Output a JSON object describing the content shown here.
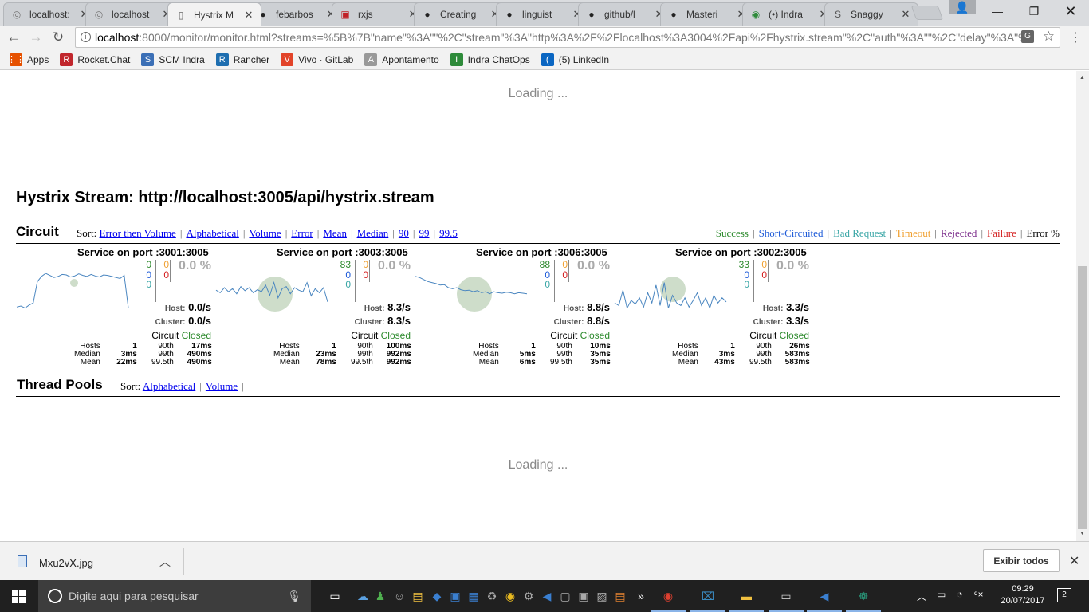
{
  "browser": {
    "tabs": [
      {
        "label": "localhost:",
        "favicon": "globe-icon"
      },
      {
        "label": "localhost",
        "favicon": "globe-icon"
      },
      {
        "label": "Hystrix M",
        "favicon": "page-icon",
        "active": true
      },
      {
        "label": "febarbos",
        "favicon": "github-icon"
      },
      {
        "label": "rxjs",
        "favicon": "npm-icon"
      },
      {
        "label": "Creating",
        "favicon": "github-icon"
      },
      {
        "label": "linguist",
        "favicon": "github-icon"
      },
      {
        "label": "github/l",
        "favicon": "github-icon"
      },
      {
        "label": "Masteri",
        "favicon": "github-icon"
      },
      {
        "label": "(•) Indra",
        "favicon": "chat-icon"
      },
      {
        "label": "Snaggy",
        "favicon": "sg-icon"
      }
    ],
    "url_host": "localhost",
    "url_rest": ":8000/monitor/monitor.html?streams=%5B%7B\"name\"%3A\"\"%2C\"stream\"%3A\"http%3A%2F%2Flocalhost%3A3004%2Fapi%2Fhystrix.stream\"%2C\"auth\"%3A\"\"%2C\"delay\"%3A\"%7",
    "bookmarks": [
      {
        "label": "Apps",
        "icon": "apps-grid-icon",
        "color": "#e65100"
      },
      {
        "label": "Rocket.Chat",
        "icon": "rocket-chat-icon",
        "color": "#c1272d"
      },
      {
        "label": "SCM Indra",
        "icon": "scm-icon",
        "color": "#3b6fb6"
      },
      {
        "label": "Rancher",
        "icon": "rancher-icon",
        "color": "#1e6eb0"
      },
      {
        "label": "Vivo · GitLab",
        "icon": "gitlab-icon",
        "color": "#e24329"
      },
      {
        "label": "Apontamento",
        "icon": "clock-icon",
        "color": "#999999"
      },
      {
        "label": "Indra ChatOps",
        "icon": "chatops-icon",
        "color": "#2e8b3a"
      },
      {
        "label": "(5) LinkedIn",
        "icon": "linkedin-icon",
        "color": "#0a66c2"
      }
    ]
  },
  "page": {
    "loading_top": "Loading ...",
    "loading_bottom": "Loading ...",
    "stream_title": "Hystrix Stream: http://localhost:3005/api/hystrix.stream",
    "circuit_title": "Circuit",
    "circuit_sort_label": "Sort:",
    "circuit_sort": [
      "Error then Volume",
      "Alphabetical",
      "Volume",
      "Error",
      "Mean",
      "Median",
      "90",
      "99",
      "99.5"
    ],
    "legend": [
      {
        "label": "Success",
        "color": "#2d8a2d"
      },
      {
        "label": "Short-Circuited",
        "color": "#1e5bd8"
      },
      {
        "label": "Bad Request",
        "color": "#3aa6a6"
      },
      {
        "label": "Timeout",
        "color": "#f0a030"
      },
      {
        "label": "Rejected",
        "color": "#7a2a8a"
      },
      {
        "label": "Failure",
        "color": "#d42020"
      },
      {
        "label": "Error %",
        "color": "#000000"
      }
    ],
    "threadpool_title": "Thread Pools",
    "threadpool_sort_label": "Sort:",
    "threadpool_sort": [
      "Alphabetical",
      "Volume"
    ]
  },
  "circuits": [
    {
      "title": "Service on port :3001:3005",
      "success": "0",
      "short_circuited": "0",
      "bad_request": "0",
      "timeout": "0",
      "failure": "0",
      "error_pct": "0.0 %",
      "host_rate": "0.0/s",
      "cluster_rate": "0.0/s",
      "circuit_label": "Circuit",
      "circuit_status": "Closed",
      "stats": {
        "hosts": "1",
        "median": "3ms",
        "mean": "22ms",
        "p90": "17ms",
        "p99": "490ms",
        "p995": "490ms"
      },
      "spark": [
        0.12,
        0.14,
        0.1,
        0.16,
        0.2,
        0.62,
        0.72,
        0.78,
        0.74,
        0.7,
        0.72,
        0.76,
        0.75,
        0.71,
        0.73,
        0.77,
        0.74,
        0.72,
        0.76,
        0.73,
        0.71,
        0.75,
        0.74,
        0.72,
        0.7,
        0.68,
        0.74,
        0.1
      ],
      "bubble_size": "small"
    },
    {
      "title": "Service on port :3003:3005",
      "success": "83",
      "short_circuited": "0",
      "bad_request": "0",
      "timeout": "0",
      "failure": "0",
      "error_pct": "0.0 %",
      "host_rate": "8.3/s",
      "cluster_rate": "8.3/s",
      "circuit_label": "Circuit",
      "circuit_status": "Closed",
      "stats": {
        "hosts": "1",
        "median": "23ms",
        "mean": "78ms",
        "p90": "100ms",
        "p99": "992ms",
        "p995": "992ms"
      },
      "spark": [
        0.45,
        0.4,
        0.5,
        0.42,
        0.48,
        0.38,
        0.52,
        0.44,
        0.5,
        0.4,
        0.46,
        0.42,
        0.55,
        0.35,
        0.6,
        0.3,
        0.48,
        0.52,
        0.38,
        0.5,
        0.45,
        0.42,
        0.6,
        0.34,
        0.48,
        0.4,
        0.5,
        0.22
      ],
      "bubble_size": "large"
    },
    {
      "title": "Service on port :3006:3005",
      "success": "88",
      "short_circuited": "0",
      "bad_request": "0",
      "timeout": "0",
      "failure": "0",
      "error_pct": "0.0 %",
      "host_rate": "8.8/s",
      "cluster_rate": "8.8/s",
      "circuit_label": "Circuit",
      "circuit_status": "Closed",
      "stats": {
        "hosts": "1",
        "median": "5ms",
        "mean": "6ms",
        "p90": "10ms",
        "p99": "35ms",
        "p995": "35ms"
      },
      "spark": [
        0.72,
        0.7,
        0.66,
        0.62,
        0.6,
        0.58,
        0.55,
        0.56,
        0.5,
        0.48,
        0.5,
        0.46,
        0.44,
        0.45,
        0.42,
        0.44,
        0.4,
        0.42,
        0.38,
        0.42,
        0.4,
        0.39,
        0.41,
        0.4,
        0.38,
        0.4,
        0.39,
        0.38
      ],
      "bubble_size": "large"
    },
    {
      "title": "Service on port :3002:3005",
      "success": "33",
      "short_circuited": "0",
      "bad_request": "0",
      "timeout": "0",
      "failure": "0",
      "error_pct": "0.0 %",
      "host_rate": "3.3/s",
      "cluster_rate": "3.3/s",
      "circuit_label": "Circuit",
      "circuit_status": "Closed",
      "stats": {
        "hosts": "1",
        "median": "3ms",
        "mean": "43ms",
        "p90": "26ms",
        "p99": "583ms",
        "p995": "583ms"
      },
      "spark": [
        0.2,
        0.15,
        0.45,
        0.1,
        0.25,
        0.18,
        0.3,
        0.12,
        0.4,
        0.2,
        0.55,
        0.15,
        0.6,
        0.1,
        0.35,
        0.2,
        0.15,
        0.3,
        0.12,
        0.25,
        0.4,
        0.15,
        0.3,
        0.1,
        0.35,
        0.2,
        0.3,
        0.22
      ],
      "bubble_size": "medium"
    }
  ],
  "stat_labels": {
    "hosts": "Hosts",
    "median": "Median",
    "mean": "Mean",
    "p90": "90th",
    "p99": "99th",
    "p995": "99.5th",
    "host": "Host:",
    "cluster": "Cluster:"
  },
  "downloads": {
    "file": "Mxu2vX.jpg",
    "show_all": "Exibir todos"
  },
  "taskbar": {
    "search_placeholder": "Digite aqui para pesquisar",
    "time": "09:29",
    "date": "20/07/2017",
    "notifications": "2",
    "language": "ᵈ×"
  }
}
